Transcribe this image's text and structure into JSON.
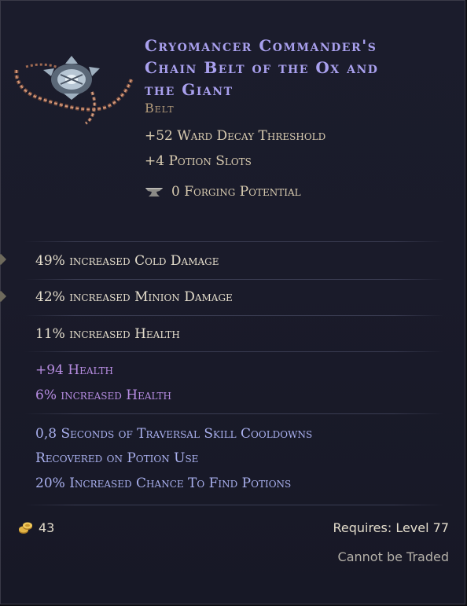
{
  "item": {
    "name_lines": [
      "Cryomancer Commander's",
      "Chain Belt of the Ox and",
      "the Giant"
    ],
    "type": "Belt",
    "icon": "chain-belt-icon"
  },
  "implicits": [
    "+52 Ward Decay Threshold",
    "+4 Potion Slots"
  ],
  "forging": {
    "icon": "anvil-icon",
    "text": "0 Forging Potential"
  },
  "affixes": [
    "49% increased Cold Damage",
    "42% increased Minion Damage",
    "11% increased Health"
  ],
  "sealed_affix": [
    "+94 Health",
    "6% increased Health"
  ],
  "set_bonus": [
    "0,8 Seconds of Traversal Skill Cooldowns",
    "Recovered on Potion Use",
    "20% Increased Chance To Find Potions"
  ],
  "footer": {
    "gold_icon": "gold-coins-icon",
    "gold_value": "43",
    "requires": "Requires: Level 77",
    "trade_status": "Cannot be Traded"
  },
  "colors": {
    "name": "#a9a0ee",
    "type": "#b59d7c",
    "sealed": "#b78de2",
    "set": "#a9b0ee",
    "affix": "#e3dccb"
  }
}
